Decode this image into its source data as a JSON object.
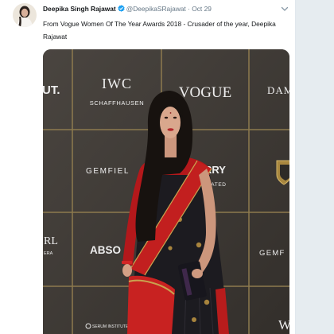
{
  "tweet": {
    "display_name": "Deepika Singh Rajawat",
    "handle": "@DeepikaSRajawat",
    "separator": "·",
    "date": "Oct 29",
    "text": "From Vogue Women Of The Year Awards 2018 - Crusader of the year, Deepika Rajawat"
  },
  "icons": {
    "verified": "verified-badge-icon",
    "menu": "chevron-down-icon",
    "avatar": "profile-photo"
  },
  "photo": {
    "logos": {
      "absolut_fragment": "UT.",
      "iwc": "IWC",
      "iwc_sub": "SCHAFFHAUSEN",
      "vogue": "VOGUE",
      "dam": "DAM",
      "gemfields": "GEMFIEL",
      "rry": "RRY",
      "rated": "RATED",
      "rl": "RL",
      "era": "ERA",
      "abso": "ABSO",
      "gemf": "GEMF",
      "serum": "SERUM INSTITUTE OF",
      "w": "W"
    }
  },
  "colors": {
    "text_primary": "#14171a",
    "text_secondary": "#657786",
    "verified": "#1da1f2",
    "page_bg": "#e6ecf0"
  }
}
